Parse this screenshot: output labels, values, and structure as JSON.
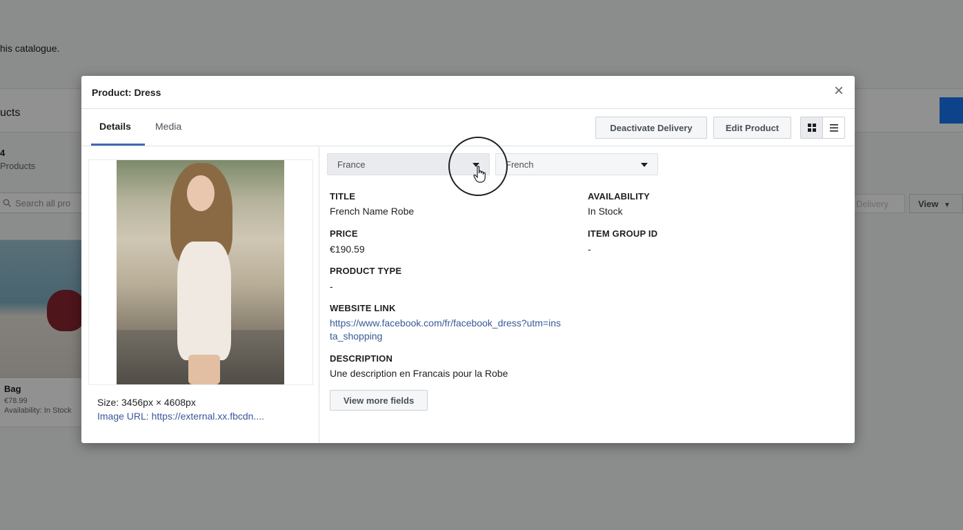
{
  "background": {
    "intro_text": "his catalogue.",
    "header_title": "ucts",
    "count_value": "4",
    "count_label": "Products",
    "search_placeholder": "Search all pro",
    "delivery_label": "Delivery",
    "view_label": "View",
    "card": {
      "name": "Bag",
      "price": "€78.99",
      "availability": "Availability: In Stock"
    }
  },
  "modal": {
    "title": "Product: Dress",
    "close_label": "×",
    "tabs": [
      {
        "label": "Details"
      },
      {
        "label": "Media"
      }
    ],
    "actions": {
      "deactivate_label": "Deactivate Delivery",
      "edit_label": "Edit Product"
    },
    "image": {
      "size_text": "Size: 3456px × 4608px",
      "url_text": "Image URL: https://external.xx.fbcdn...."
    },
    "selects": {
      "country": "France",
      "language": "French"
    },
    "fields": {
      "title": {
        "label": "TITLE",
        "value": "French Name Robe"
      },
      "price": {
        "label": "PRICE",
        "value": "€190.59"
      },
      "product_type": {
        "label": "PRODUCT TYPE",
        "value": "-"
      },
      "website_link": {
        "label": "WEBSITE LINK",
        "value": "https://www.facebook.com/fr/facebook_dress?utm=insta_shopping"
      },
      "description": {
        "label": "DESCRIPTION",
        "value": "Une description en Francais pour la Robe"
      },
      "availability": {
        "label": "AVAILABILITY",
        "value": "In Stock"
      },
      "item_group_id": {
        "label": "ITEM GROUP ID",
        "value": "-"
      }
    },
    "view_more_label": "View more fields"
  }
}
